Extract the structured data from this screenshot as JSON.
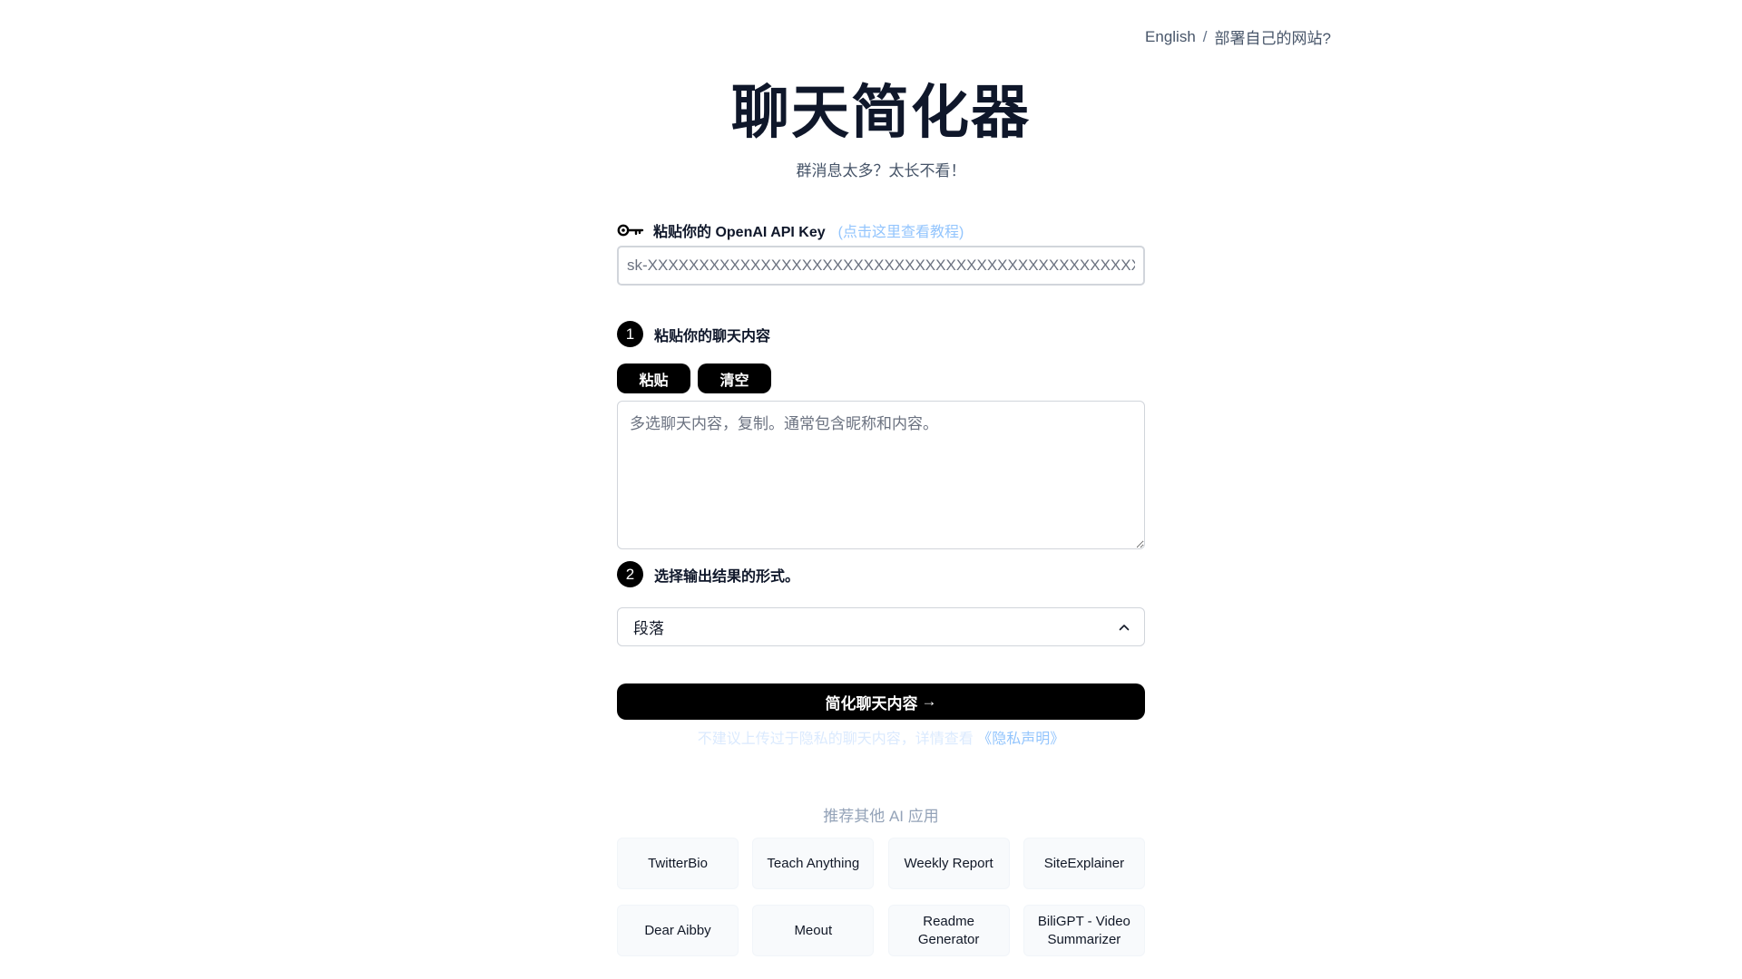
{
  "nav": {
    "english": "English",
    "separator": "/",
    "deploy": "部署自己的网站?"
  },
  "header": {
    "title": "聊天简化器",
    "subtitle": "群消息太多？太长不看！"
  },
  "api_key": {
    "label": "粘贴你的 OpenAI API Key",
    "tutorial": "(点击这里查看教程)",
    "placeholder": "sk-XXXXXXXXXXXXXXXXXXXXXXXXXXXXXXXXXXXXXXXXXXXXXXXXX",
    "icon": "key-icon"
  },
  "step1": {
    "number": "1",
    "label": "粘贴你的聊天内容",
    "paste_label": "粘贴",
    "clear_label": "清空",
    "textarea_placeholder": "多选聊天内容，复制。通常包含昵称和内容。"
  },
  "step2": {
    "number": "2",
    "label": "选择输出结果的形式。",
    "selected": "段落",
    "icon": "chevron-up-icon"
  },
  "submit": {
    "label": "简化聊天内容",
    "arrow": "→"
  },
  "privacy": {
    "text": "不建议上传过于隐私的聊天内容，详情查看",
    "link": "《隐私声明》"
  },
  "recommend": {
    "title": "推荐其他 AI 应用",
    "apps": [
      "TwitterBio",
      "Teach Anything",
      "Weekly Report",
      "SiteExplainer",
      "Dear Aibby",
      "Meout",
      "Readme Generator",
      "BiliGPT - Video Summarizer"
    ]
  },
  "colors": {
    "primary": "#000000",
    "link_blue": "#93c5fd",
    "muted": "#94a3b8"
  }
}
